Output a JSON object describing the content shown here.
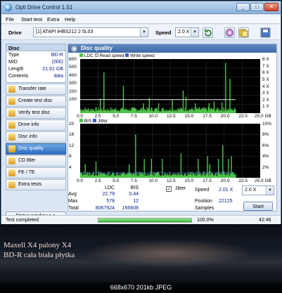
{
  "window": {
    "title": "Opti Drive Control 1.51",
    "controls": {
      "minimize": "_",
      "maximize": "□",
      "close": "✕"
    }
  },
  "menu": [
    "File",
    "Start test",
    "Extra",
    "Help"
  ],
  "toolbar": {
    "drive_label": "Drive",
    "drive_value": "[1]  ATAPI iHBS212   2 5L03",
    "speed_label": "Speed",
    "speed_value": "2.0 X"
  },
  "disc": {
    "header": "Disc",
    "rows": [
      {
        "key": "Type",
        "value": "BD-R"
      },
      {
        "key": "MID",
        "value": "(000)"
      },
      {
        "key": "Length",
        "value": "21.61 GB"
      },
      {
        "key": "Contents",
        "value": "data"
      }
    ]
  },
  "nav": [
    {
      "label": "Transfer rate"
    },
    {
      "label": "Create test disc"
    },
    {
      "label": "Verify test disc"
    },
    {
      "label": "Drive info"
    },
    {
      "label": "Disc info"
    },
    {
      "label": "Disc quality"
    },
    {
      "label": "CD Bler"
    },
    {
      "label": "FE / TE"
    },
    {
      "label": "Extra tests"
    }
  ],
  "status_window_button": "Status window > >",
  "panel": {
    "title": "Disc quality"
  },
  "chart_data": [
    {
      "type": "bar",
      "legend": [
        "LDC",
        "Read speed",
        "Write speed"
      ],
      "x": [
        "0.0",
        "2.5",
        "5.0",
        "7.5",
        "10.0",
        "12.5",
        "15.0",
        "17.5",
        "20.0",
        "22.5",
        "25.0 GB"
      ],
      "yleft": [
        "600",
        "500",
        "400",
        "300",
        "200",
        "100"
      ],
      "yright": [
        "8 X",
        "7 X",
        "6 X",
        "5 X",
        "4 X",
        "3 X",
        "2 X",
        "1 X"
      ],
      "xlim": [
        0,
        25
      ],
      "ylim": [
        0,
        600
      ],
      "data_end": 21.6,
      "spikes": [
        [
          2.8,
          160
        ],
        [
          3.3,
          450
        ],
        [
          6.0,
          300
        ],
        [
          8.8,
          110
        ],
        [
          9.6,
          170
        ],
        [
          10.9,
          110
        ],
        [
          12.8,
          150
        ],
        [
          14.3,
          250
        ],
        [
          14.7,
          180
        ],
        [
          16.0,
          110
        ],
        [
          17.9,
          110
        ],
        [
          18.6,
          130
        ],
        [
          19.7,
          120
        ],
        [
          20.2,
          560
        ],
        [
          20.8,
          380
        ]
      ],
      "baseline": 45,
      "read_speed_x": 2.0,
      "colors": {
        "ldc": "#4ec24a",
        "read": "#e0e0e0",
        "write": "#3a5fcd"
      }
    },
    {
      "type": "bar",
      "legend": [
        "BIS",
        "Jitter"
      ],
      "x": [
        "0.0",
        "2.5",
        "5.0",
        "7.5",
        "10.0",
        "12.5",
        "15.0",
        "17.5",
        "20.0",
        "22.5",
        "25.0 GB"
      ],
      "yleft": [
        "20",
        "16",
        "12",
        "8",
        "4"
      ],
      "yright": [
        "10%",
        "8%",
        "6%",
        "4%",
        "2%"
      ],
      "xlim": [
        0,
        25
      ],
      "ylim": [
        0,
        20
      ],
      "data_end": 21.6,
      "spikes": [
        [
          0.7,
          5
        ],
        [
          2.2,
          6
        ],
        [
          6.8,
          5
        ],
        [
          7.7,
          16
        ],
        [
          8.9,
          7
        ],
        [
          9.9,
          7
        ],
        [
          11.4,
          7
        ],
        [
          14.0,
          9
        ],
        [
          16.4,
          7
        ],
        [
          17.7,
          8
        ],
        [
          18.0,
          5
        ],
        [
          19.2,
          7
        ],
        [
          19.8,
          12
        ],
        [
          20.6,
          7
        ],
        [
          21.0,
          8
        ]
      ],
      "baseline": 1.6,
      "colors": {
        "bis": "#4ec24a",
        "jitter": "#3a5fcd"
      }
    }
  ],
  "stats": {
    "col_ldc": "LDC",
    "col_bis": "BIS",
    "rows": [
      {
        "label": "Avg",
        "ldc": "22.79",
        "bis": "0.44"
      },
      {
        "label": "Max",
        "ldc": "578",
        "bis": "12"
      },
      {
        "label": "Total",
        "ldc": "8067924",
        "bis": "156608"
      }
    ],
    "jitter_label": "Jitter",
    "jitter_checked": "✓",
    "speed_label": "Speed",
    "speed_value": "2.01 X",
    "speed_select": "2.0 X",
    "position_label": "Position",
    "position_value": "22125",
    "samples_label": "Samples",
    "start_button": "Start"
  },
  "statusbar": {
    "status": "Test completed",
    "progress_percent": 100,
    "progress_text": "100.0%",
    "time": "42:46"
  },
  "caption": {
    "line1": "Maxell X4 palony X4",
    "line2": "BD-R  cała biała płytka"
  },
  "footer": "668x670 201kb JPEG"
}
